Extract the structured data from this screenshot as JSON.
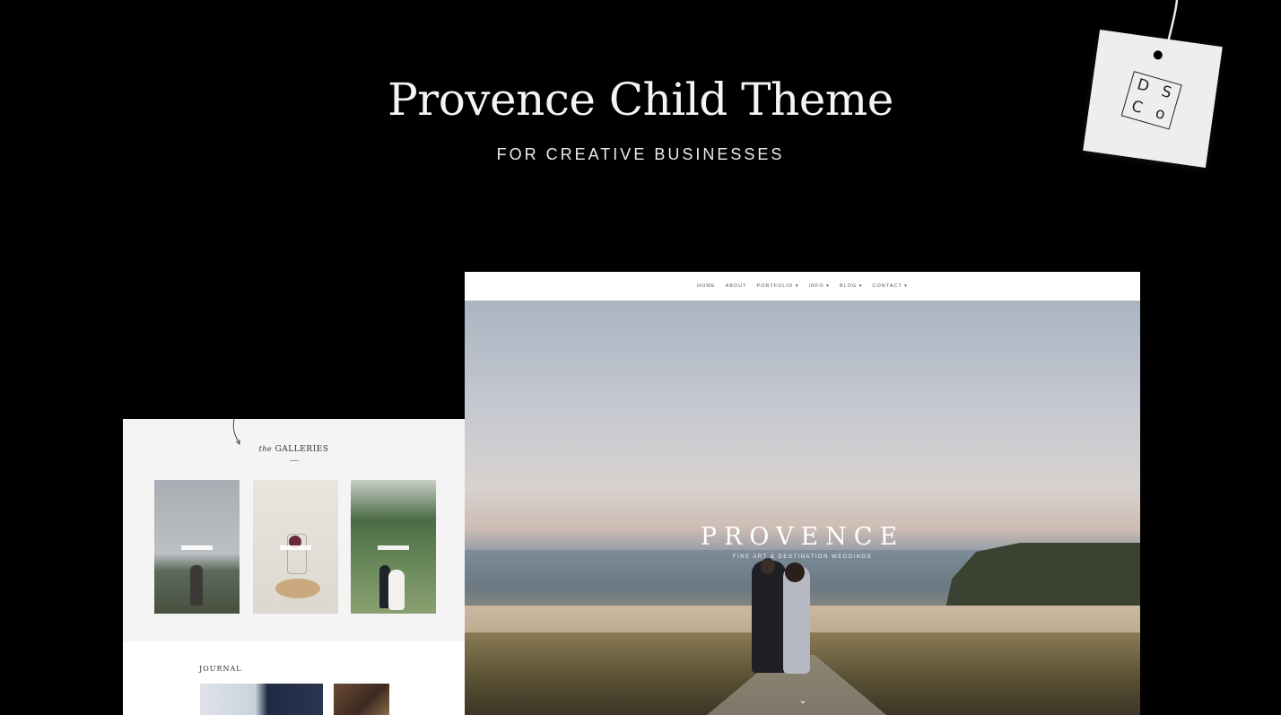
{
  "promo": {
    "title": "Provence Child Theme",
    "subtitle": "FOR CREATIVE BUSINESSES"
  },
  "hang_tag": {
    "logo_letters": [
      "D",
      "S",
      "C",
      "o"
    ]
  },
  "main_window": {
    "nav": [
      "HOME",
      "ABOUT",
      "PORTFOLIO ▾",
      "INFO ▾",
      "BLOG ▾",
      "CONTACT ▾"
    ],
    "hero_title": "PROVENCE",
    "hero_tagline": "FINE ART & DESTINATION WEDDINGS",
    "scroll_icon": "chevron-down-icon"
  },
  "left_window": {
    "galleries_script": "the",
    "galleries_heading": "GALLERIES",
    "journal_heading": "JOURNAL"
  },
  "colors": {
    "background": "#000000",
    "title_text": "#f4f4f2",
    "window_bg": "#ffffff",
    "left_window_bg": "#f5f4f4"
  }
}
